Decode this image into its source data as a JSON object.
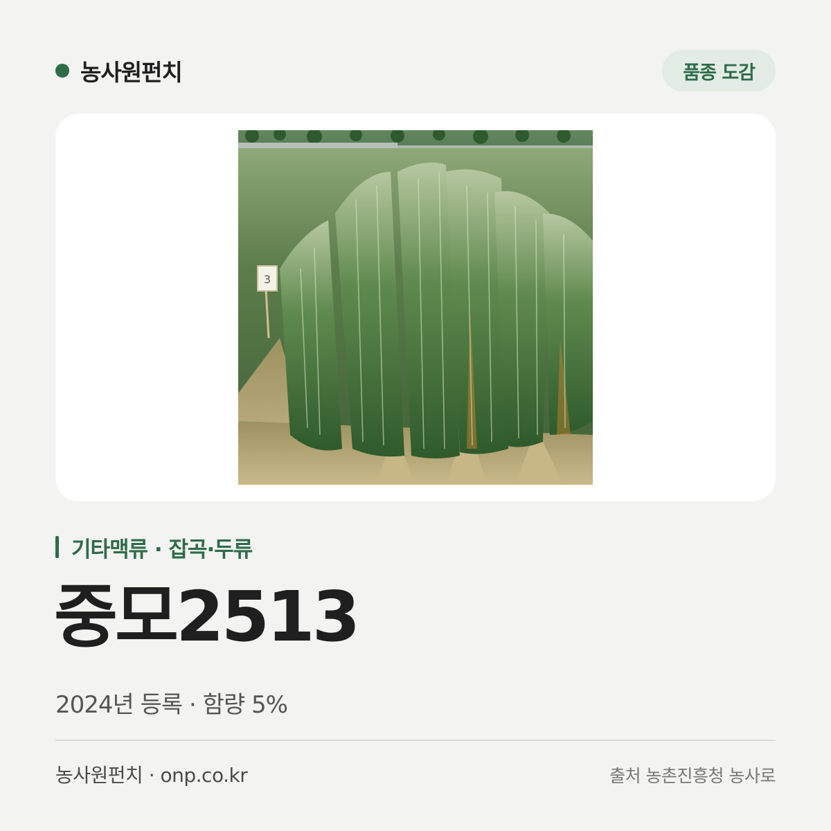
{
  "header": {
    "brand_name": "농사원펀치",
    "badge_label": "품종 도감"
  },
  "photo": {
    "description_icon": "field-photo",
    "sign_text": "3"
  },
  "category": {
    "label": "기타맥류 · 잡곡·두류"
  },
  "variety": {
    "name": "중모2513"
  },
  "meta": {
    "text": "2024년 등록 · 함량 5%"
  },
  "footer": {
    "site": "농사원펀치 · onp.co.kr",
    "source": "출처 농촌진흥청 농사로"
  },
  "colors": {
    "accent": "#2f6b49",
    "badge_bg": "#e2ece4",
    "background": "#f3f3f1"
  }
}
